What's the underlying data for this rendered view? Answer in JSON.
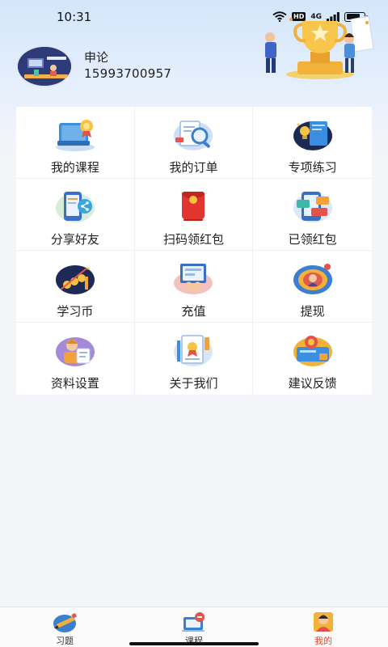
{
  "status_bar": {
    "time": "10:31",
    "hd_label": "HD",
    "network_label": "4G",
    "battery_level": 0.8
  },
  "profile": {
    "name": "申论",
    "phone": "15993700957"
  },
  "menu": {
    "items": [
      {
        "label": "我的课程",
        "icon": "book-medal-icon"
      },
      {
        "label": "我的订单",
        "icon": "order-search-icon"
      },
      {
        "label": "专项练习",
        "icon": "practice-book-icon"
      },
      {
        "label": "分享好友",
        "icon": "share-icon"
      },
      {
        "label": "扫码领红包",
        "icon": "red-envelope-icon"
      },
      {
        "label": "已领红包",
        "icon": "received-envelope-icon"
      },
      {
        "label": "学习币",
        "icon": "study-coin-icon"
      },
      {
        "label": "充值",
        "icon": "recharge-icon"
      },
      {
        "label": "提现",
        "icon": "withdraw-icon"
      },
      {
        "label": "资料设置",
        "icon": "profile-settings-icon"
      },
      {
        "label": "关于我们",
        "icon": "about-certificate-icon"
      },
      {
        "label": "建议反馈",
        "icon": "feedback-icon"
      }
    ]
  },
  "tabbar": {
    "tabs": [
      {
        "label": "习题",
        "icon": "exercise-pencil-icon",
        "active": false
      },
      {
        "label": "课程",
        "icon": "course-icon",
        "active": false
      },
      {
        "label": "我的",
        "icon": "me-avatar-icon",
        "active": true
      }
    ],
    "active_color": "#e0492f"
  }
}
